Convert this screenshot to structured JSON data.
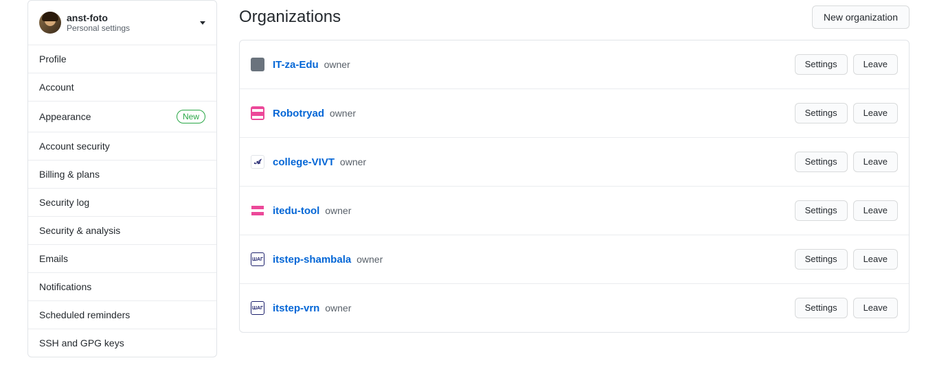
{
  "user": {
    "name": "anst-foto",
    "subtitle": "Personal settings"
  },
  "sidebar": {
    "items": [
      {
        "label": "Profile",
        "badge": null
      },
      {
        "label": "Account",
        "badge": null
      },
      {
        "label": "Appearance",
        "badge": "New"
      },
      {
        "label": "Account security",
        "badge": null
      },
      {
        "label": "Billing & plans",
        "badge": null
      },
      {
        "label": "Security log",
        "badge": null
      },
      {
        "label": "Security & analysis",
        "badge": null
      },
      {
        "label": "Emails",
        "badge": null
      },
      {
        "label": "Notifications",
        "badge": null
      },
      {
        "label": "Scheduled reminders",
        "badge": null
      },
      {
        "label": "SSH and GPG keys",
        "badge": null
      }
    ]
  },
  "page": {
    "title": "Organizations",
    "new_button": "New organization"
  },
  "orgs": {
    "settings_label": "Settings",
    "leave_label": "Leave",
    "items": [
      {
        "name": "IT-za-Edu",
        "role": "owner"
      },
      {
        "name": "Robotryad",
        "role": "owner"
      },
      {
        "name": "college-VIVT",
        "role": "owner"
      },
      {
        "name": "itedu-tool",
        "role": "owner"
      },
      {
        "name": "itstep-shambala",
        "role": "owner"
      },
      {
        "name": "itstep-vrn",
        "role": "owner"
      }
    ]
  }
}
